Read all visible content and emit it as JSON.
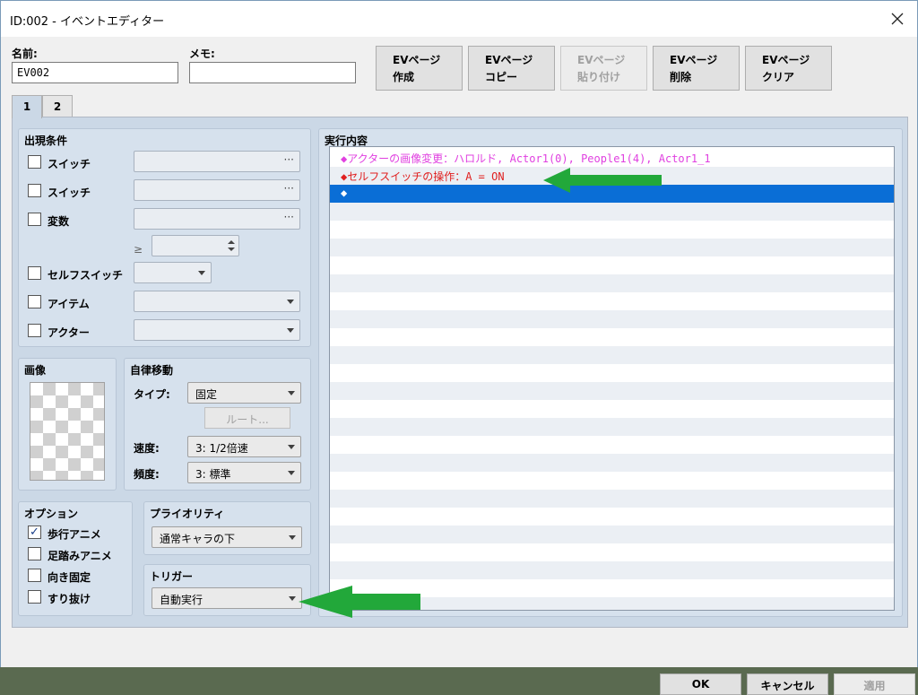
{
  "window": {
    "title": "ID:002 - イベントエディター"
  },
  "header": {
    "name_label": "名前:",
    "name_value": "EV002",
    "memo_label": "メモ:",
    "memo_value": "",
    "buttons": [
      {
        "line1": "EVページ",
        "line2": "作成",
        "enabled": true
      },
      {
        "line1": "EVページ",
        "line2": "コピー",
        "enabled": true
      },
      {
        "line1": "EVページ",
        "line2": "貼り付け",
        "enabled": false
      },
      {
        "line1": "EVページ",
        "line2": "削除",
        "enabled": true
      },
      {
        "line1": "EVページ",
        "line2": "クリア",
        "enabled": true
      }
    ]
  },
  "tabs": [
    "1",
    "2"
  ],
  "conditions": {
    "title": "出現条件",
    "switch1": "スイッチ",
    "switch2": "スイッチ",
    "variable": "変数",
    "gte": "≥",
    "self_switch": "セルフスイッチ",
    "item": "アイテム",
    "actor": "アクター",
    "dots": "···"
  },
  "image_group": {
    "title": "画像"
  },
  "movement": {
    "title": "自律移動",
    "type_label": "タイプ:",
    "type_value": "固定",
    "route_button": "ルート...",
    "speed_label": "速度:",
    "speed_value": "3: 1/2倍速",
    "freq_label": "頻度:",
    "freq_value": "3: 標準"
  },
  "options": {
    "title": "オプション",
    "items": [
      {
        "label": "歩行アニメ",
        "checked": true
      },
      {
        "label": "足踏みアニメ",
        "checked": false
      },
      {
        "label": "向き固定",
        "checked": false
      },
      {
        "label": "すり抜け",
        "checked": false
      }
    ],
    "check_mark": "✓"
  },
  "priority": {
    "title": "プライオリティ",
    "value": "通常キャラの下"
  },
  "trigger": {
    "title": "トリガー",
    "value": "自動実行"
  },
  "contents": {
    "title": "実行内容",
    "lines": [
      "◆アクターの画像変更：ハロルド, Actor1(0), People1(4), Actor1_1",
      "◆セルフスイッチの操作：A = ON",
      "◆"
    ],
    "colors": {
      "actor_change": "#e040e0",
      "self_switch": "#e02020",
      "selected": "#0a6ed6"
    }
  },
  "footer": {
    "ok": "OK",
    "cancel": "キャンセル",
    "apply": "適用"
  },
  "annotation_color": "#22a83a"
}
